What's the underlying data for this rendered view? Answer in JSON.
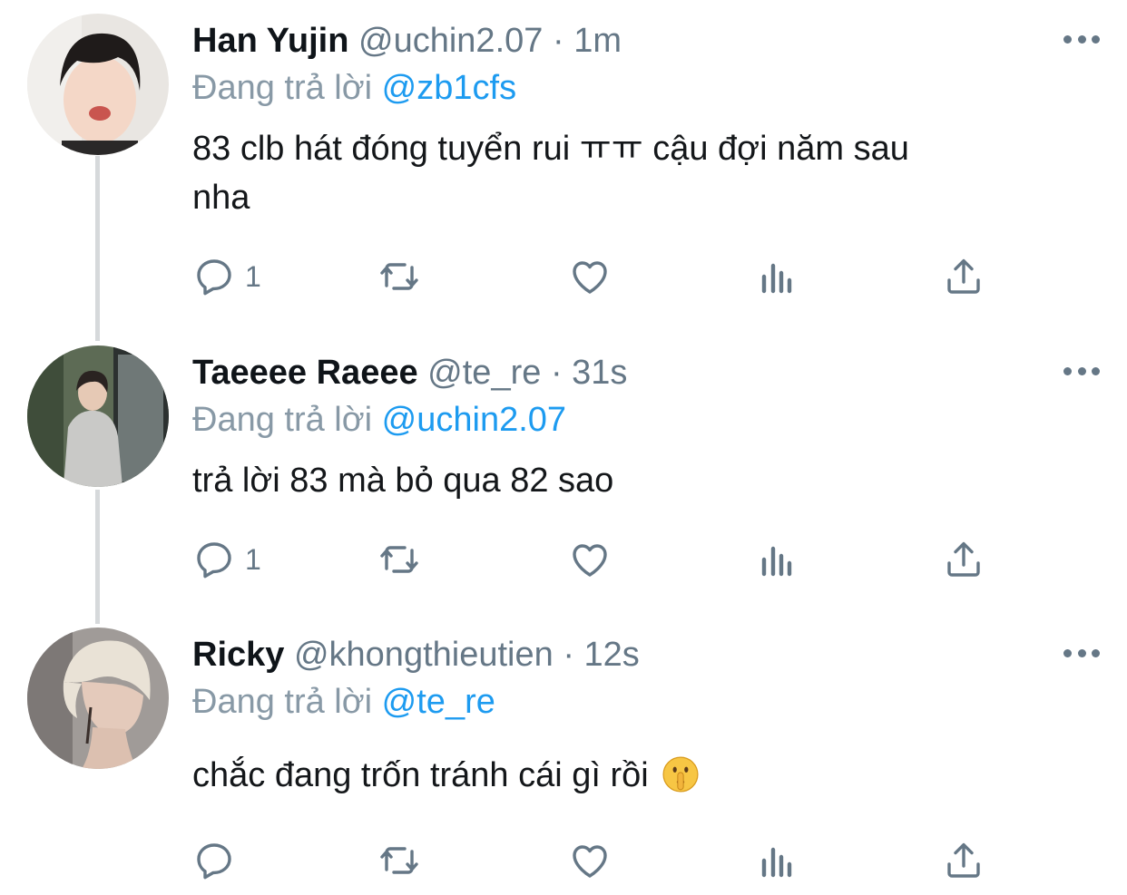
{
  "tweets": [
    {
      "name": "Han Yujin",
      "handle": "@uchin2.07",
      "separator": "·",
      "time": "1m",
      "reply_prefix": "Đang trả lời",
      "reply_to": "@zb1cfs",
      "text_line1": "83 clb hát đóng tuyển rui ㅠㅠ cậu đợi năm sau",
      "text_line2": "nha",
      "reply_count": "1",
      "avatar_icon": "avatar-photo"
    },
    {
      "name": "Taeeee Raeee",
      "handle": "@te_re",
      "separator": "·",
      "time": "31s",
      "reply_prefix": "Đang trả lời",
      "reply_to": "@uchin2.07",
      "text_line1": "trả lời 83 mà bỏ qua 82 sao",
      "reply_count": "1",
      "avatar_icon": "avatar-photo"
    },
    {
      "name": "Ricky",
      "handle": "@khongthieutien",
      "separator": "·",
      "time": "12s",
      "reply_prefix": "Đang trả lời",
      "reply_to": "@te_re",
      "text_line1": "chắc đang trốn tránh cái gì rồi",
      "text_emoji": "shushing-face-emoji",
      "reply_count": "",
      "avatar_icon": "avatar-photo"
    }
  ],
  "colors": {
    "text": "#0f1419",
    "secondary": "#657786",
    "mention": "#1d9bf0",
    "thread_line": "#d6d9db"
  },
  "icons": [
    "reply-icon",
    "retweet-icon",
    "like-icon",
    "views-icon",
    "share-icon",
    "more-icon"
  ]
}
